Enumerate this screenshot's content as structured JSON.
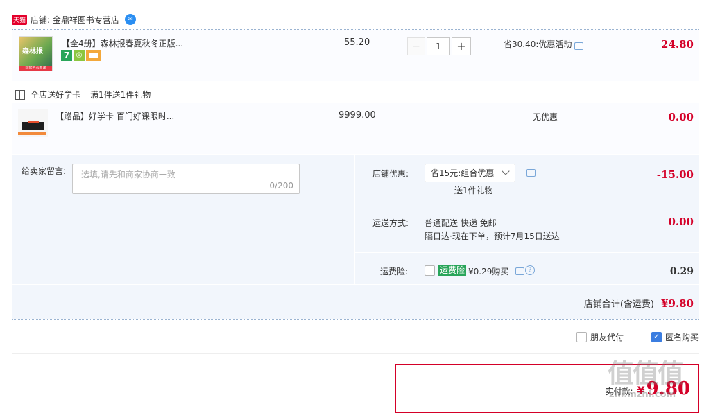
{
  "store": {
    "badge_text": "天猫",
    "label": "店铺: 金鼎祥图书专营店"
  },
  "item1": {
    "title": "【全4册】森林报春夏秋冬正版...",
    "cover_text": "森林报",
    "cover_banner": "国家名著新课",
    "badge_seven": "7",
    "unit_price": "55.20",
    "qty": "1",
    "qty_minus": "−",
    "qty_plus": "+",
    "discount": "省30.40:优惠活动",
    "subtotal": "24.80"
  },
  "gift_section": {
    "label": "全店送好学卡",
    "promo": "满1件送1件礼物"
  },
  "item2": {
    "title": "【赠品】好学卡 百门好课限时...",
    "unit_price": "9999.00",
    "discount": "无优惠",
    "subtotal": "0.00"
  },
  "message": {
    "label": "给卖家留言:",
    "placeholder": "选填,请先和商家协商一致",
    "counter": "0/200"
  },
  "store_discount": {
    "label": "店铺优惠:",
    "selected": "省15元:组合优惠",
    "sub": "送1件礼物",
    "amount": "-15.00"
  },
  "shipping": {
    "label": "运送方式:",
    "method": "普通配送 快递 免邮",
    "eta": "隔日达·现在下单，预计7月15日送达",
    "amount": "0.00"
  },
  "insurance": {
    "label": "运费险:",
    "tag": "运费险",
    "price": "¥0.29购买",
    "amount": "0.29"
  },
  "total": {
    "label": "店铺合计(含运费)",
    "amount": "¥9.80"
  },
  "options": {
    "friend_pay": "朋友代付",
    "anonymous": "匿名购买"
  },
  "payment": {
    "label": "实付款:",
    "currency": "¥",
    "amount": "9.80"
  },
  "watermark": {
    "text": "值值值",
    "site": "zhi.mzhi.com"
  },
  "colors": {
    "price_red": "#d40028",
    "divider_blue": "#9ab3d1",
    "check_blue": "#3b7de0",
    "insurance_green": "#29a55a"
  }
}
